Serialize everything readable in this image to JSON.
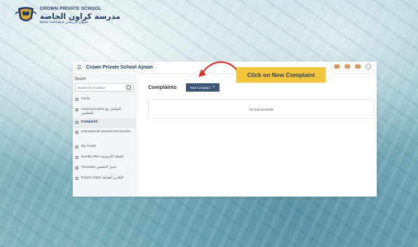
{
  "logo": {
    "name_en": "CROWN PRIVATE SCHOOL",
    "name_ar": "مدرسة كراون الخاصة",
    "curriculum": "British Curriculum المنهاج البريطاني"
  },
  "app": {
    "title": "Crown Private School Ajman",
    "search": {
      "label": "Search",
      "placeholder": "Search for modules"
    },
    "nav": [
      {
        "label": "Home",
        "icon": "home-icon"
      },
      {
        "label": "Communication التواصل مع المعلمين",
        "icon": "chat-icon"
      },
      {
        "label": "Complaint",
        "icon": "complaint-icon",
        "active": true
      },
      {
        "label": "International Assessment Results",
        "icon": "assessment-icon"
      },
      {
        "label": "My Profile",
        "icon": "profile-icon"
      },
      {
        "label": "Weekly Plan الخطة الأسبوعية",
        "icon": "calendar-icon"
      },
      {
        "label": "Timetable جدول الحصص",
        "icon": "timetable-icon"
      },
      {
        "label": "Report Cards التقارير الفصلية",
        "icon": "report-icon"
      }
    ],
    "main": {
      "title": "Complaints",
      "new_button": "New Complaint",
      "empty_text": "No data available"
    }
  },
  "annotation": {
    "callout_text": "Click on New Complaint",
    "color": "#f2c53d",
    "arrow_color": "#d9322b"
  }
}
